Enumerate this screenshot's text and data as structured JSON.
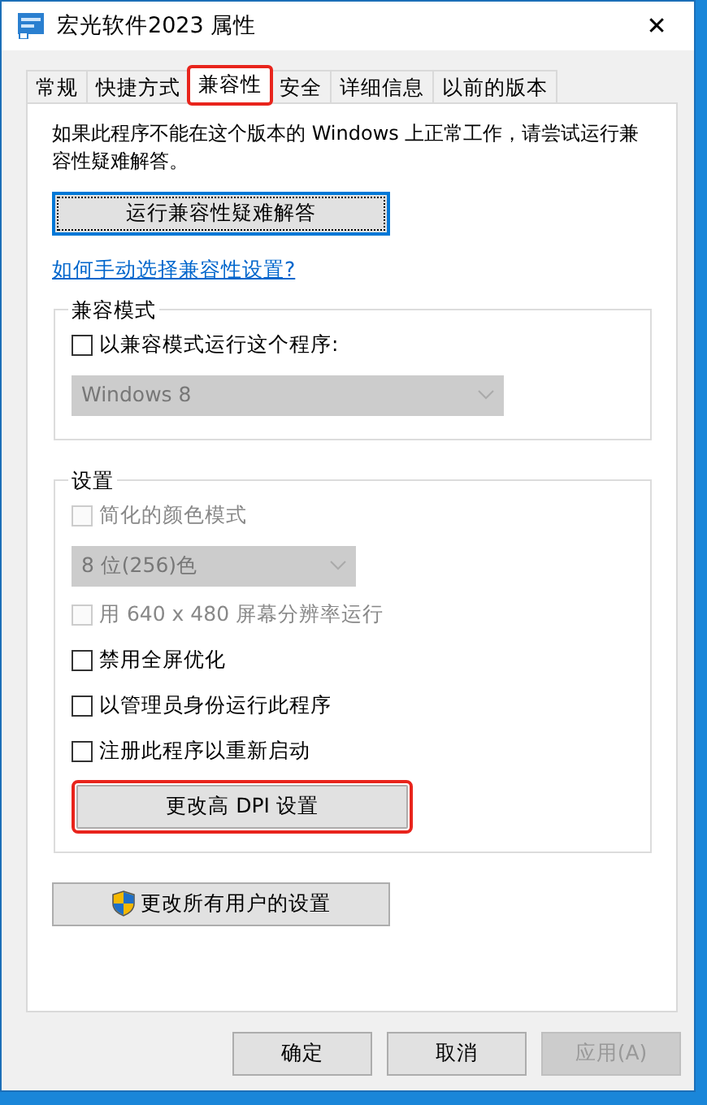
{
  "window": {
    "title": "宏光软件2023 属性",
    "close": "✕"
  },
  "tabs": [
    {
      "label": "常规",
      "selected": false,
      "highlighted": false
    },
    {
      "label": "快捷方式",
      "selected": false,
      "highlighted": false
    },
    {
      "label": "兼容性",
      "selected": true,
      "highlighted": true
    },
    {
      "label": "安全",
      "selected": false,
      "highlighted": false
    },
    {
      "label": "详细信息",
      "selected": false,
      "highlighted": false
    },
    {
      "label": "以前的版本",
      "selected": false,
      "highlighted": false
    }
  ],
  "intro": "如果此程序不能在这个版本的 Windows 上正常工作，请尝试运行兼容性疑难解答。",
  "troubleshoot_button": {
    "label": "运行兼容性疑难解答",
    "focused": true
  },
  "help_link": "如何手动选择兼容性设置?",
  "groups": [
    {
      "title": "兼容模式",
      "items": [
        {
          "kind": "checkbox",
          "label": "以兼容模式运行这个程序:",
          "checked": false,
          "disabled": false
        },
        {
          "kind": "select",
          "value": "Windows 8",
          "disabled": true
        }
      ]
    },
    {
      "title": "设置",
      "items": [
        {
          "kind": "checkbox",
          "label": "简化的颜色模式",
          "checked": false,
          "disabled": true
        },
        {
          "kind": "select",
          "value": "8 位(256)色",
          "disabled": true
        },
        {
          "kind": "checkbox",
          "label": "用 640 x 480 屏幕分辨率运行",
          "checked": false,
          "disabled": true
        },
        {
          "kind": "checkbox",
          "label": "禁用全屏优化",
          "checked": false,
          "disabled": false
        },
        {
          "kind": "checkbox",
          "label": "以管理员身份运行此程序",
          "checked": false,
          "disabled": false
        },
        {
          "kind": "checkbox",
          "label": "注册此程序以重新启动",
          "checked": false,
          "disabled": false
        },
        {
          "kind": "button",
          "label": "更改高 DPI 设置",
          "highlighted": true
        }
      ]
    }
  ],
  "all_users_button": {
    "label": "更改所有用户的设置"
  },
  "footer_buttons": [
    {
      "label": "确定",
      "disabled": false
    },
    {
      "label": "取消",
      "disabled": false
    },
    {
      "label": "应用(A)",
      "disabled": true
    }
  ]
}
